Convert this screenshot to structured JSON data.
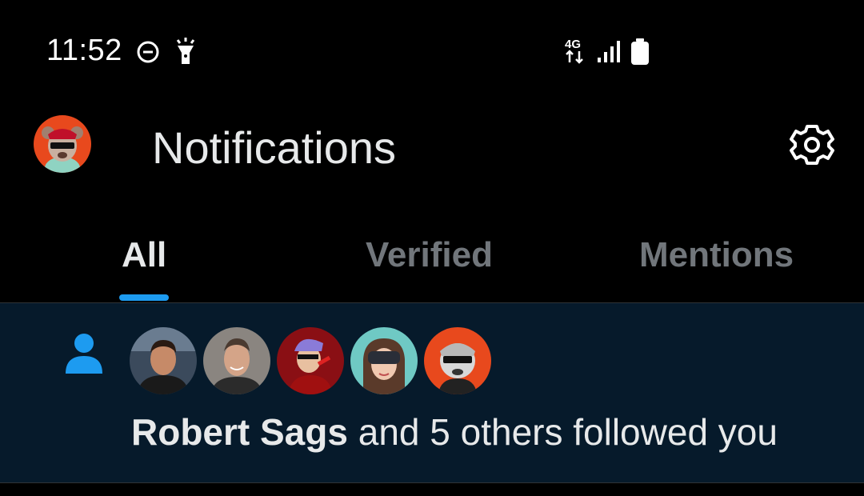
{
  "status_bar": {
    "time": "11:52",
    "network_label": "4G",
    "icons": [
      "do-not-disturb-icon",
      "flashlight-icon",
      "network-4g-icon",
      "signal-icon",
      "battery-icon"
    ]
  },
  "header": {
    "title": "Notifications",
    "avatar": "profile-avatar",
    "settings_icon": "gear-icon"
  },
  "tabs": [
    {
      "label": "All",
      "active": true
    },
    {
      "label": "Verified",
      "active": false
    },
    {
      "label": "Mentions",
      "active": false
    }
  ],
  "notification": {
    "icon": "person-icon",
    "name": "Robert Sags",
    "rest": " and 5 others followed you",
    "avatars": [
      "follower-avatar-1",
      "follower-avatar-2",
      "follower-avatar-3",
      "follower-avatar-4",
      "follower-avatar-5"
    ]
  },
  "colors": {
    "accent": "#1d9bf0",
    "background": "#000000",
    "notification_bg": "#061a2b",
    "text_primary": "#e7e9ea",
    "text_secondary": "#71767b"
  }
}
